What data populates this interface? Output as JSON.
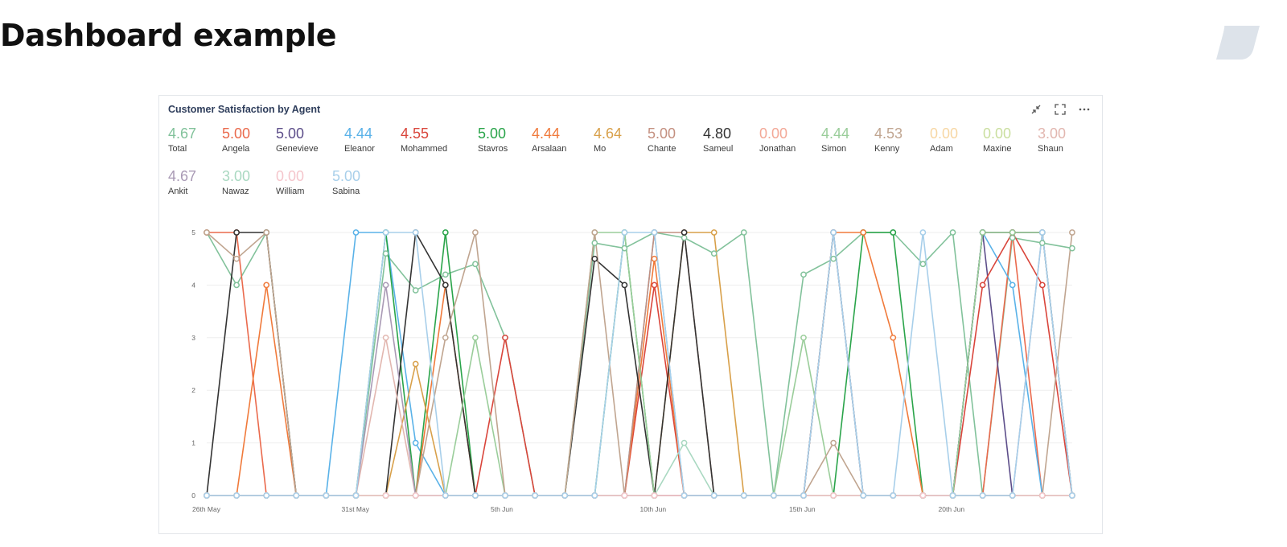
{
  "page": {
    "title": "Dashboard example"
  },
  "widget": {
    "title": "Customer Satisfaction by Agent"
  },
  "colors": {
    "text": "#111111",
    "accent_logo": "#dde3ea",
    "card_border": "#e3e6ea"
  },
  "icons": [
    "collapse-icon",
    "fullscreen-icon",
    "more-icon"
  ],
  "stats": [
    {
      "value": "4.67",
      "label": "Total",
      "color": "#82c29b"
    },
    {
      "value": "5.00",
      "label": "Angela",
      "color": "#ea6a4d"
    },
    {
      "value": "5.00",
      "label": "Genevieve",
      "color": "#5d4e8a"
    },
    {
      "value": "4.44",
      "label": "Eleanor",
      "color": "#5ab2e8"
    },
    {
      "value": "4.55",
      "label": "Mohammed",
      "color": "#d9453b"
    },
    {
      "value": "5.00",
      "label": "Stavros",
      "color": "#2aa44a"
    },
    {
      "value": "4.44",
      "label": "Arsalaan",
      "color": "#f07a3b"
    },
    {
      "value": "4.64",
      "label": "Mo",
      "color": "#d8a04a"
    },
    {
      "value": "5.00",
      "label": "Chante",
      "color": "#c49080"
    },
    {
      "value": "4.80",
      "label": "Sameul",
      "color": "#333333"
    },
    {
      "value": "0.00",
      "label": "Jonathan",
      "color": "#f3a897"
    },
    {
      "value": "4.44",
      "label": "Simon",
      "color": "#9acd9a"
    },
    {
      "value": "4.53",
      "label": "Kenny",
      "color": "#c0a590"
    },
    {
      "value": "0.00",
      "label": "Adam",
      "color": "#f7d7a4"
    },
    {
      "value": "0.00",
      "label": "Maxine",
      "color": "#cadf9f"
    },
    {
      "value": "3.00",
      "label": "Shaun",
      "color": "#e2b7b0"
    },
    {
      "value": "4.67",
      "label": "Ankit",
      "color": "#a99ab5"
    },
    {
      "value": "3.00",
      "label": "Nawaz",
      "color": "#a9d8c1"
    },
    {
      "value": "0.00",
      "label": "William",
      "color": "#f5c6cc"
    },
    {
      "value": "5.00",
      "label": "Sabina",
      "color": "#a8cfea"
    }
  ],
  "chart_data": {
    "type": "line",
    "x": [
      "26th May",
      "27th May",
      "28th May",
      "29th May",
      "30th May",
      "31st May",
      "1st Jun",
      "2nd Jun",
      "3rd Jun",
      "4th Jun",
      "5th Jun",
      "6th Jun",
      "7th Jun",
      "8th Jun",
      "9th Jun",
      "10th Jun",
      "11th Jun",
      "12th Jun",
      "13th Jun",
      "14th Jun",
      "15th Jun",
      "16th Jun",
      "17th Jun",
      "18th Jun",
      "19th Jun",
      "20th Jun",
      "21st Jun",
      "22nd Jun",
      "23rd Jun",
      "24th Jun"
    ],
    "x_ticks": [
      "26th May",
      "31st May",
      "5th Jun",
      "10th Jun",
      "15th Jun",
      "20th Jun"
    ],
    "y_ticks": [
      0,
      1,
      2,
      3,
      4,
      5
    ],
    "ylim": [
      0,
      5
    ],
    "grid": true,
    "series": [
      {
        "name": "Total",
        "color": "#82c29b",
        "values": [
          5,
          4,
          5,
          0,
          0,
          0,
          4.6,
          3.9,
          4.2,
          4.4,
          3,
          0,
          0,
          4.8,
          4.7,
          5,
          4.9,
          4.6,
          5,
          0,
          4.2,
          4.5,
          5,
          5,
          4.4,
          5,
          0,
          4.9,
          4.8,
          4.7
        ]
      },
      {
        "name": "Angela",
        "color": "#ea6a4d",
        "values": [
          5,
          5,
          0,
          0,
          0,
          0,
          0,
          0,
          0,
          0,
          0,
          0,
          0,
          0,
          0,
          0,
          0,
          0,
          0,
          0,
          0,
          0,
          0,
          0,
          0,
          0,
          0,
          5,
          0,
          0
        ]
      },
      {
        "name": "Genevieve",
        "color": "#5d4e8a",
        "values": [
          0,
          0,
          0,
          0,
          0,
          0,
          0,
          0,
          0,
          0,
          0,
          0,
          0,
          0,
          0,
          0,
          0,
          0,
          0,
          0,
          0,
          0,
          0,
          0,
          0,
          0,
          5,
          0,
          0,
          0
        ]
      },
      {
        "name": "Eleanor",
        "color": "#5ab2e8",
        "values": [
          0,
          0,
          0,
          0,
          0,
          5,
          5,
          1,
          0,
          0,
          0,
          0,
          0,
          0,
          0,
          5,
          0,
          0,
          0,
          0,
          0,
          0,
          0,
          0,
          0,
          0,
          5,
          4,
          0,
          0
        ]
      },
      {
        "name": "Mohammed",
        "color": "#d9453b",
        "values": [
          0,
          0,
          0,
          0,
          0,
          0,
          0,
          0,
          0,
          0,
          3,
          0,
          0,
          0,
          0,
          4,
          0,
          0,
          0,
          0,
          0,
          0,
          0,
          0,
          0,
          0,
          4,
          5,
          4,
          0
        ]
      },
      {
        "name": "Stavros",
        "color": "#2aa44a",
        "values": [
          0,
          0,
          0,
          0,
          0,
          0,
          5,
          0,
          5,
          0,
          0,
          0,
          0,
          0,
          5,
          0,
          0,
          0,
          0,
          0,
          0,
          0,
          5,
          5,
          0,
          0,
          0,
          0,
          0,
          0
        ]
      },
      {
        "name": "Arsalaan",
        "color": "#f07a3b",
        "values": [
          0,
          0,
          4,
          0,
          0,
          0,
          0,
          0,
          4,
          0,
          0,
          0,
          0,
          0,
          0,
          4.5,
          0,
          0,
          0,
          0,
          0,
          5,
          5,
          3,
          0,
          0,
          0,
          0,
          0,
          0
        ]
      },
      {
        "name": "Mo",
        "color": "#d8a04a",
        "values": [
          0,
          0,
          0,
          0,
          0,
          0,
          0,
          2.5,
          0,
          0,
          0,
          0,
          0,
          0,
          0,
          0,
          5,
          5,
          0,
          0,
          0,
          0,
          0,
          0,
          0,
          0,
          0,
          0,
          0,
          0
        ]
      },
      {
        "name": "Chante",
        "color": "#c49080",
        "values": [
          0,
          0,
          0,
          0,
          0,
          0,
          0,
          0,
          0,
          0,
          0,
          0,
          0,
          0,
          0,
          5,
          5,
          0,
          0,
          0,
          0,
          0,
          0,
          0,
          0,
          0,
          0,
          0,
          0,
          0
        ]
      },
      {
        "name": "Sameul",
        "color": "#333333",
        "values": [
          0,
          5,
          5,
          0,
          0,
          0,
          0,
          5,
          4,
          0,
          0,
          0,
          0,
          4.5,
          4,
          0,
          5,
          0,
          0,
          0,
          0,
          5,
          0,
          0,
          0,
          0,
          5,
          5,
          5,
          0
        ]
      },
      {
        "name": "Jonathan",
        "color": "#f3a897",
        "values": [
          0,
          0,
          0,
          0,
          0,
          0,
          0,
          0,
          0,
          0,
          0,
          0,
          0,
          0,
          0,
          0,
          0,
          0,
          0,
          0,
          0,
          0,
          0,
          0,
          0,
          0,
          0,
          0,
          0,
          0
        ]
      },
      {
        "name": "Simon",
        "color": "#9acd9a",
        "values": [
          0,
          0,
          0,
          0,
          0,
          0,
          0,
          0,
          0,
          3,
          0,
          0,
          0,
          5,
          5,
          0,
          0,
          0,
          0,
          0,
          3,
          0,
          0,
          0,
          0,
          0,
          5,
          5,
          5,
          0
        ]
      },
      {
        "name": "Kenny",
        "color": "#c0a590",
        "values": [
          5,
          4.5,
          5,
          0,
          0,
          0,
          0,
          0,
          3,
          5,
          0,
          0,
          0,
          5,
          0,
          0,
          0,
          0,
          0,
          0,
          0,
          1,
          0,
          0,
          0,
          0,
          0,
          0,
          0,
          5
        ]
      },
      {
        "name": "Adam",
        "color": "#f7d7a4",
        "values": [
          0,
          0,
          0,
          0,
          0,
          0,
          0,
          0,
          0,
          0,
          0,
          0,
          0,
          0,
          0,
          0,
          0,
          0,
          0,
          0,
          0,
          0,
          0,
          0,
          0,
          0,
          0,
          0,
          0,
          0
        ]
      },
      {
        "name": "Maxine",
        "color": "#cadf9f",
        "values": [
          0,
          0,
          0,
          0,
          0,
          0,
          0,
          0,
          0,
          0,
          0,
          0,
          0,
          0,
          0,
          0,
          0,
          0,
          0,
          0,
          0,
          0,
          0,
          0,
          0,
          0,
          0,
          0,
          0,
          0
        ]
      },
      {
        "name": "Shaun",
        "color": "#e2b7b0",
        "values": [
          0,
          0,
          0,
          0,
          0,
          0,
          3,
          0,
          0,
          0,
          0,
          0,
          0,
          0,
          0,
          0,
          0,
          0,
          0,
          0,
          0,
          0,
          0,
          0,
          0,
          0,
          0,
          0,
          0,
          0
        ]
      },
      {
        "name": "Ankit",
        "color": "#a99ab5",
        "values": [
          0,
          0,
          0,
          0,
          0,
          0,
          4,
          0,
          0,
          0,
          0,
          0,
          0,
          0,
          0,
          0,
          0,
          0,
          0,
          0,
          0,
          5,
          0,
          0,
          0,
          0,
          0,
          0,
          5,
          0
        ]
      },
      {
        "name": "Nawaz",
        "color": "#a9d8c1",
        "values": [
          0,
          0,
          0,
          0,
          0,
          0,
          0,
          0,
          0,
          0,
          0,
          0,
          0,
          0,
          0,
          0,
          1,
          0,
          0,
          0,
          0,
          0,
          0,
          0,
          0,
          0,
          0,
          0,
          0,
          0
        ]
      },
      {
        "name": "William",
        "color": "#f5c6cc",
        "values": [
          0,
          0,
          0,
          0,
          0,
          0,
          0,
          0,
          0,
          0,
          0,
          0,
          0,
          0,
          0,
          0,
          0,
          0,
          0,
          0,
          0,
          0,
          0,
          0,
          0,
          0,
          0,
          0,
          0,
          0
        ]
      },
      {
        "name": "Sabina",
        "color": "#a8cfea",
        "values": [
          0,
          0,
          0,
          0,
          0,
          0,
          5,
          5,
          0,
          0,
          0,
          0,
          0,
          0,
          5,
          5,
          0,
          0,
          0,
          0,
          0,
          5,
          0,
          0,
          5,
          0,
          0,
          0,
          5,
          0
        ]
      }
    ]
  }
}
